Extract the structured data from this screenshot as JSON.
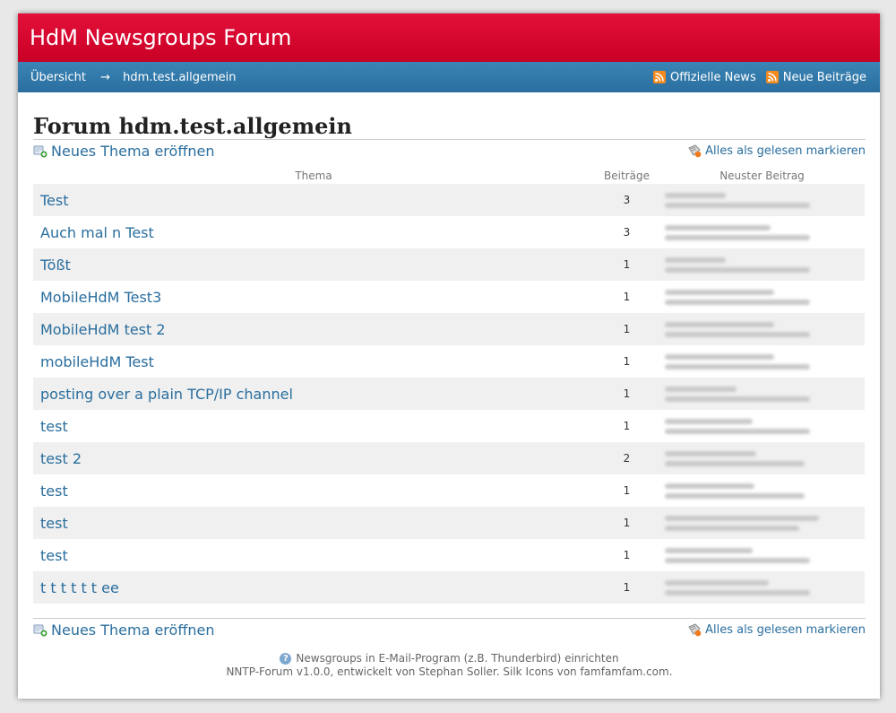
{
  "header": {
    "title": "HdM Newsgroups Forum"
  },
  "nav": {
    "breadcrumb_home": "Übersicht",
    "breadcrumb_sep": "→",
    "breadcrumb_current": "hdm.test.allgemein",
    "official_news": "Offizielle News",
    "new_posts": "Neue Beiträge",
    "rss_icon": "rss-feed-icon",
    "accent": "#f58a1f"
  },
  "main": {
    "title": "Forum hdm.test.allgemein",
    "new_thread_label": "Neues Thema eröffnen",
    "mark_read_label": "Alles als gelesen markieren",
    "columns": [
      "Thema",
      "Beiträge",
      "Neuster Beitrag"
    ],
    "threads": [
      {
        "topic": "Test",
        "count": "3"
      },
      {
        "topic": "Auch mal n Test",
        "count": "3"
      },
      {
        "topic": "Tößt",
        "count": "1"
      },
      {
        "topic": "MobileHdM Test3",
        "count": "1"
      },
      {
        "topic": "MobileHdM test 2",
        "count": "1"
      },
      {
        "topic": "mobileHdM Test",
        "count": "1"
      },
      {
        "topic": "posting over a plain TCP/IP channel",
        "count": "1"
      },
      {
        "topic": "test",
        "count": "1"
      },
      {
        "topic": "test 2",
        "count": "2"
      },
      {
        "topic": "test",
        "count": "1"
      },
      {
        "topic": "test",
        "count": "1"
      },
      {
        "topic": "test",
        "count": "1"
      },
      {
        "topic": "t t t t t t ee",
        "count": "1"
      }
    ]
  },
  "footer": {
    "help_text": "Newsgroups in E-Mail-Program (z.B. Thunderbird) einrichten",
    "credits": "NNTP-Forum v1.0.0, entwickelt von Stephan Soller. Silk Icons von famfamfam.com."
  },
  "colors": {
    "header_red": "#d8062f",
    "nav_blue": "#2f77a8",
    "link_blue": "#2a6e9e"
  }
}
